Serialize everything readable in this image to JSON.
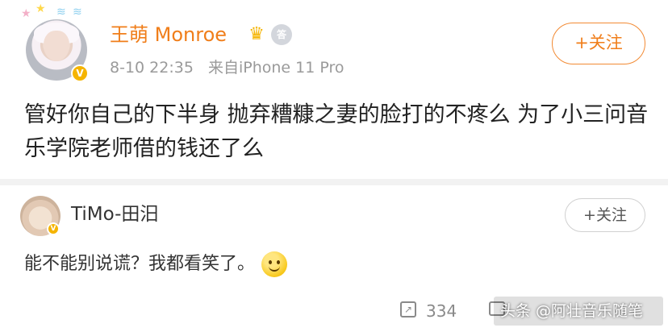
{
  "post": {
    "author": "王萌 Monroe",
    "verified_badge": "V",
    "medal_label": "答",
    "timestamp": "8-10 22:35",
    "source": "来自iPhone 11 Pro",
    "follow_label": "+关注",
    "text": "管好你自己的下半身 抛弃糟糠之妻的脸打的不疼么 为了小三问音乐学院老师借的钱还了么"
  },
  "comment": {
    "author": "TiMo-田汨",
    "verified_badge": "V",
    "follow_label": "+关注",
    "text": "能不能别说谎？我都看笑了。",
    "share_count": "334"
  },
  "watermark": "头条 @阿壮音乐随笔",
  "colors": {
    "accent_orange": "#f07e1a",
    "divider_gray": "#f2f2f2",
    "verified_gold": "#f5b400"
  }
}
